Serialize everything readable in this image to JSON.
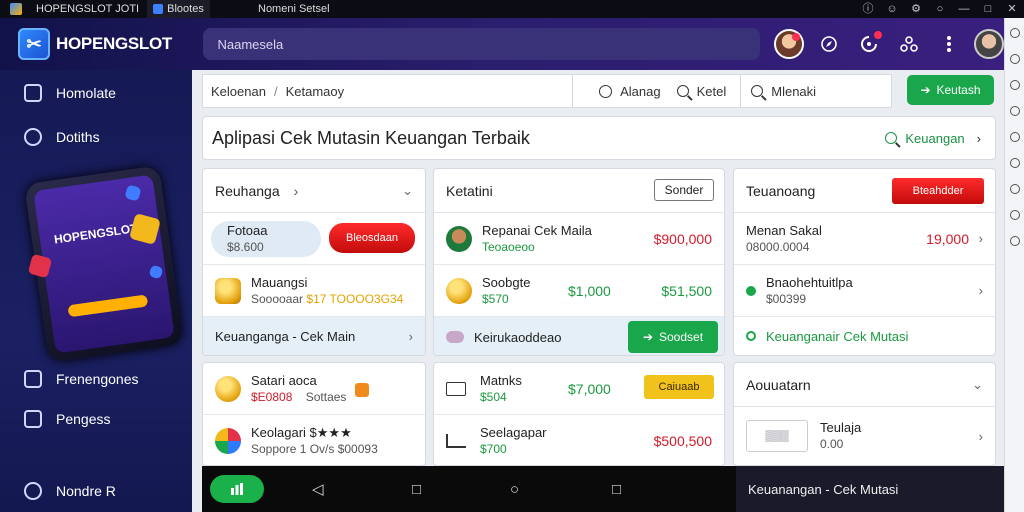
{
  "window": {
    "app_tab": "HOPENGSLOT",
    "app_tab_suffix": "JOTI",
    "second_tab": "Blootes",
    "center_title": "Nomeni Setsel",
    "controls": [
      "ⓘ",
      "☺",
      "⚙",
      "○",
      "—",
      "□",
      "✕"
    ]
  },
  "header": {
    "brand": "HOPENGSLOT",
    "brand_mark": "✂",
    "search_value": "Naamesela",
    "icons": [
      "avatar",
      "compass-icon",
      "alert-icon",
      "users-icon",
      "more-icon",
      "avatar"
    ]
  },
  "sidebar": {
    "items_top": [
      {
        "label": "Homolate",
        "icon": "home-icon"
      },
      {
        "label": "Dotiths",
        "icon": "leaf-icon"
      }
    ],
    "phone_title": "HOPENGSLOT",
    "items_bottom": [
      {
        "label": "Frenengones",
        "icon": "chart-icon"
      },
      {
        "label": "Pengess",
        "icon": "grid-icon"
      },
      {
        "label": "Nondre R",
        "icon": "settings-icon"
      }
    ]
  },
  "toolbar": {
    "crumb1": "Keloenan",
    "crumb_sep": "/",
    "crumb2": "Ketamaoy",
    "tool1": "Alanag",
    "tool2": "Ketel",
    "search_label": "Mlenaki",
    "button": "Keutash"
  },
  "banner": {
    "title": "Aplipasi Cek Mutasin Keuangan Terbaik",
    "link": "Keuangan"
  },
  "panel_left": {
    "title": "Reuhanga",
    "rows": [
      {
        "t1": "Fotoaa",
        "t2": "$8.600",
        "pill": "Bleosdaan"
      },
      {
        "t1": "Mauangsi",
        "t2": "Sooooaar",
        "t2_accent": "$17 TOOOO3G34"
      },
      {
        "label": "Keuanganga - Cek Main"
      }
    ]
  },
  "panel_mid": {
    "title": "Ketatini",
    "button": "Sonder",
    "rows": [
      {
        "t1": "Repanai Cek Maila",
        "t2": "Teoaoeoo",
        "amount": "$900,000"
      },
      {
        "t1": "Soobgte",
        "t2": "$570",
        "amount_a": "$1,000",
        "amount_b": "$51,500"
      },
      {
        "label": "Keirukaoddeao",
        "button": "Soodset"
      }
    ]
  },
  "panel_right": {
    "title": "Teuanoang",
    "pill": "Bteahdder",
    "rows": [
      {
        "t1": "Menan Sakal",
        "t2": "08000.0004",
        "amount": "19,000"
      },
      {
        "t1": "Bnaohehtuitlpa",
        "t2": "$00399"
      },
      {
        "label": "Keuanganair Cek Mutasi"
      }
    ]
  },
  "panel_left2": {
    "rows": [
      {
        "t1": "Satari aoca",
        "t2": "$E0808",
        "t3": "Sottaes"
      },
      {
        "t1": "Keolagari $★★★",
        "t2": "Soppore 1 Ov/s $00093"
      }
    ]
  },
  "panel_mid2": {
    "rows": [
      {
        "t1": "Matnks",
        "t2": "$504",
        "amount": "$7,000",
        "badge": "Caiuaab"
      },
      {
        "t1": "Seelagapar",
        "t2": "$700",
        "amount": "$500,500"
      }
    ]
  },
  "panel_right2": {
    "title": "Aouuatarn",
    "rows": [
      {
        "t1": "Teulaja",
        "t2": "0.00",
        "thumb": "▒▒▒"
      }
    ]
  },
  "navbar": {
    "bottom_note": "Keuanangan - Cek Mutasi"
  },
  "colors": {
    "accent_green": "#1aa64a",
    "accent_red": "#d31b2a",
    "header_bg": "#2a1e6e"
  }
}
